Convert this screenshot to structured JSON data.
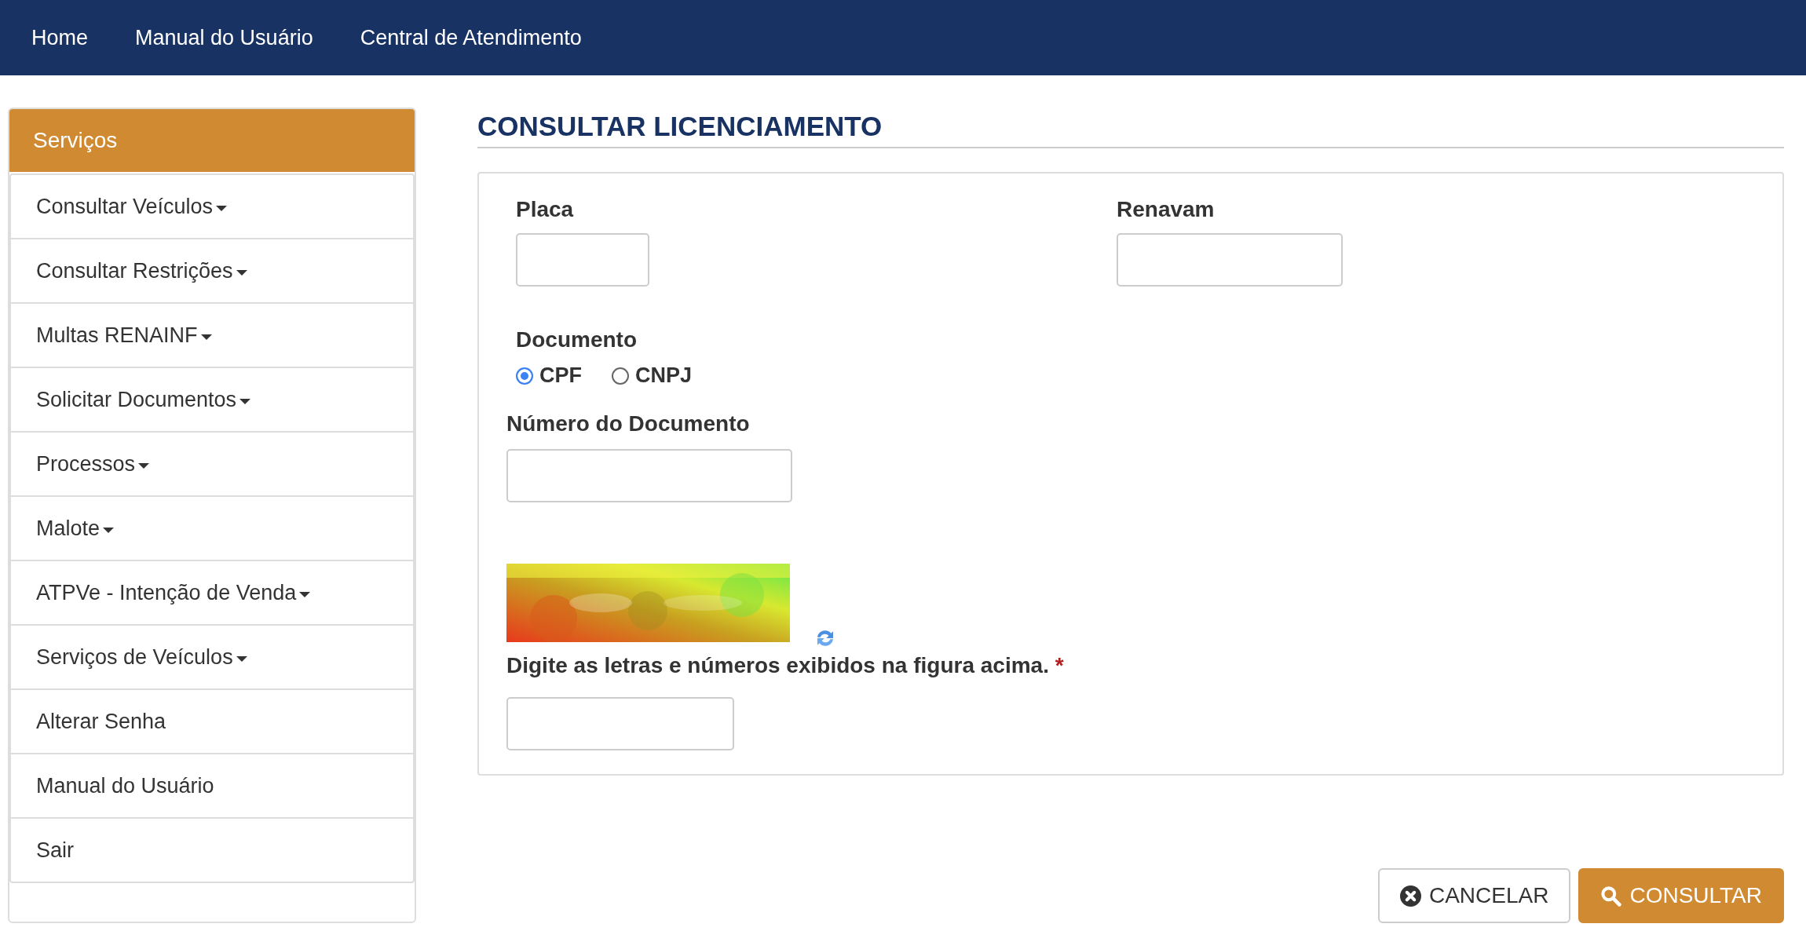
{
  "navbar": {
    "links": [
      "Home",
      "Manual do Usuário",
      "Central de Atendimento"
    ]
  },
  "sidebar": {
    "title": "Serviços",
    "items": [
      {
        "label": "Consultar Veículos",
        "dropdown": true
      },
      {
        "label": "Consultar Restrições",
        "dropdown": true
      },
      {
        "label": "Multas RENAINF",
        "dropdown": true
      },
      {
        "label": "Solicitar Documentos",
        "dropdown": true
      },
      {
        "label": "Processos",
        "dropdown": true
      },
      {
        "label": "Malote",
        "dropdown": true
      },
      {
        "label": "ATPVe - Intenção de Venda",
        "dropdown": true
      },
      {
        "label": "Serviços de Veículos",
        "dropdown": true
      },
      {
        "label": "Alterar Senha",
        "dropdown": false
      },
      {
        "label": "Manual do Usuário",
        "dropdown": false
      },
      {
        "label": "Sair",
        "dropdown": false
      }
    ]
  },
  "page": {
    "title": "CONSULTAR LICENCIAMENTO"
  },
  "form": {
    "placa": {
      "label": "Placa"
    },
    "renavam": {
      "label": "Renavam"
    },
    "documento": {
      "label": "Documento",
      "options": [
        {
          "label": "CPF",
          "selected": true
        },
        {
          "label": "CNPJ",
          "selected": false
        }
      ]
    },
    "numero": {
      "label": "Número do Documento"
    },
    "captcha": {
      "label": "Digite as letras e números exibidos na figura acima.",
      "required_mark": "*"
    }
  },
  "buttons": [
    {
      "label": "CANCELAR",
      "kind": "cancel"
    },
    {
      "label": "CONSULTAR",
      "kind": "submit"
    }
  ]
}
